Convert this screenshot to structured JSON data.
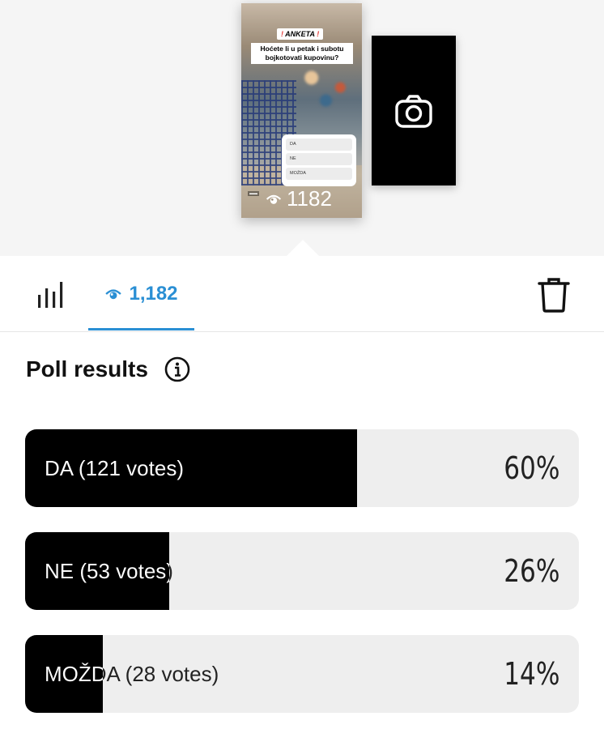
{
  "story_preview": {
    "poll_tag": "ANKETA",
    "poll_tag_marks": "!",
    "question": "Hoćete li u petak i subotu bojkotovati kupovinu?",
    "options": [
      "DA",
      "NE",
      "MOŽDA"
    ],
    "views": "1182",
    "icon": "eye-icon"
  },
  "camera_tile": {
    "icon": "camera-icon"
  },
  "tabs": {
    "insights_icon": "bar-chart-icon",
    "views_count": "1,182",
    "views_icon": "eye-icon",
    "delete_icon": "trash-icon"
  },
  "poll": {
    "title": "Poll results",
    "info_icon": "info-icon",
    "results": [
      {
        "label": "DA (121 votes)",
        "percent_text": "60%",
        "fill": 0.6
      },
      {
        "label": "NE (53 votes)",
        "percent_text": "26%",
        "fill": 0.26
      },
      {
        "label": "MOŽDA (28 votes)",
        "percent_text": "14%",
        "fill": 0.14
      }
    ]
  },
  "colors": {
    "accent": "#2a8fd4",
    "bar_fill": "#000000",
    "bar_track": "#eeeeee",
    "tag_exclamation": "#e53935"
  }
}
